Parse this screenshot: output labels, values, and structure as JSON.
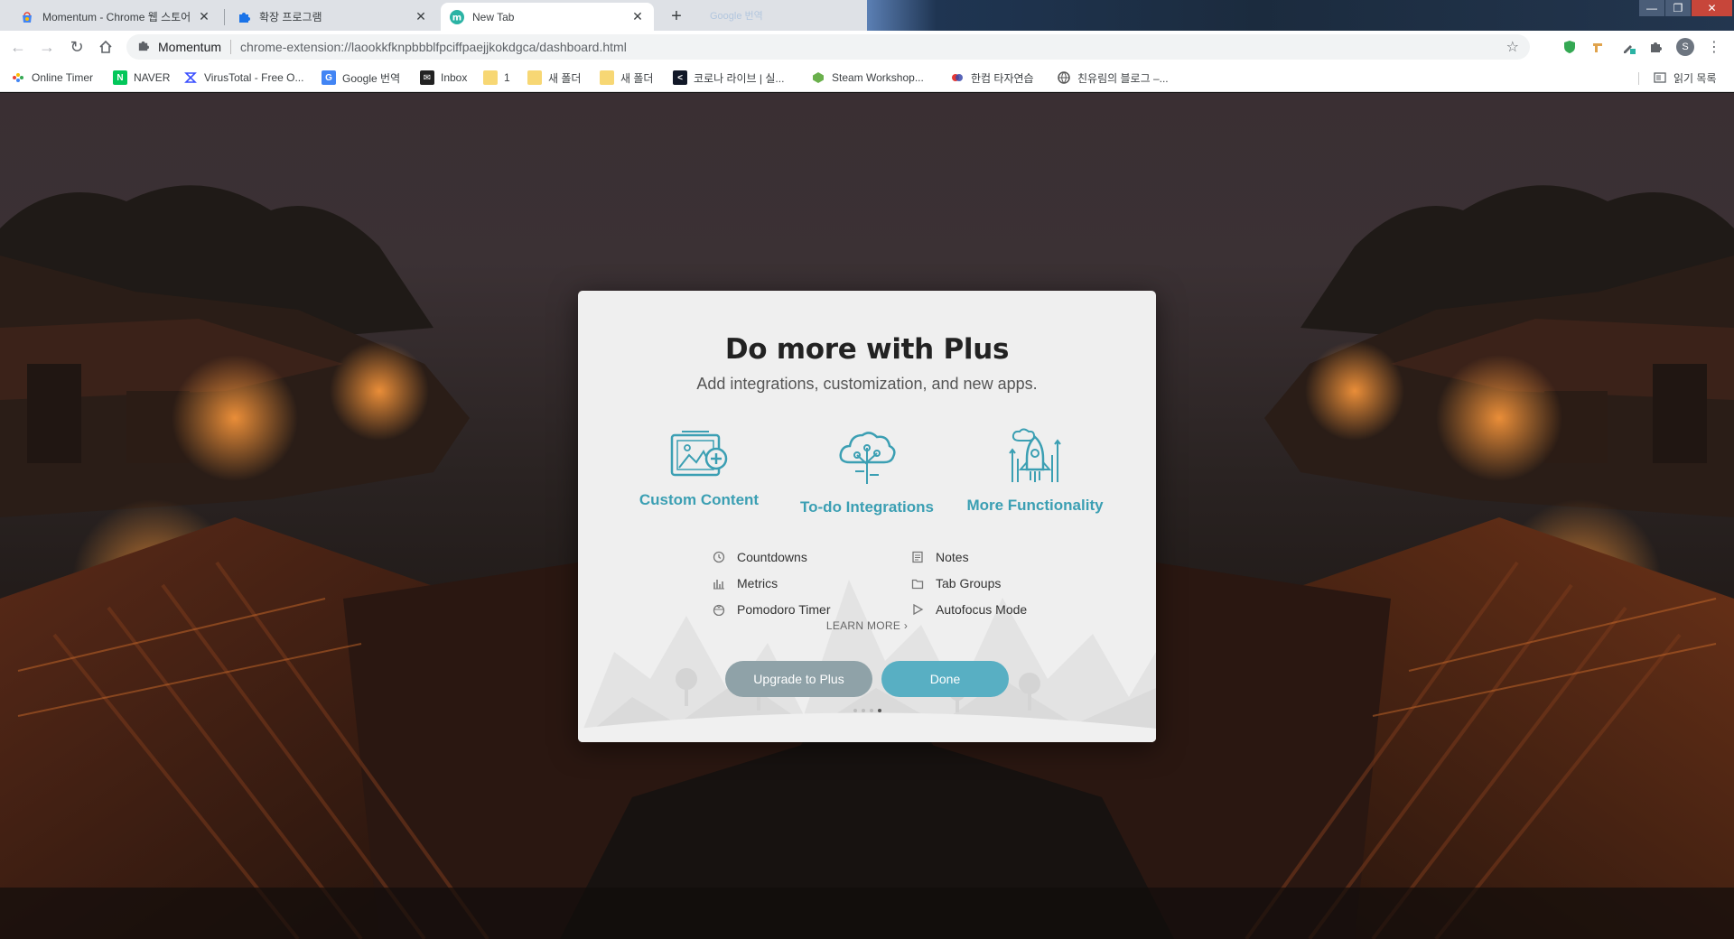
{
  "browser": {
    "tabs": [
      {
        "title": "Momentum - Chrome 웹 스토어",
        "icon": "chrome-webstore-icon",
        "active": false
      },
      {
        "title": "확장 프로그램",
        "icon": "puzzle-icon",
        "active": false
      },
      {
        "title": "New Tab",
        "icon": "momentum-icon",
        "active": true
      }
    ],
    "ghost_tab_title": "Google 번역",
    "omnibox": {
      "site_name": "Momentum",
      "url": "chrome-extension://laookkfknpbbblfpciffpaejjkokdgca/dashboard.html"
    },
    "profile_initial": "S",
    "bookmarks": [
      {
        "label": "Online Timer",
        "icon": "online-timer-icon"
      },
      {
        "label": "NAVER",
        "icon": "naver-icon"
      },
      {
        "label": "VirusTotal - Free O...",
        "icon": "virustotal-icon"
      },
      {
        "label": "Google 번역",
        "icon": "google-translate-icon"
      },
      {
        "label": "Inbox",
        "icon": "inbox-icon"
      },
      {
        "label": "1",
        "icon": "folder-icon"
      },
      {
        "label": "새 폴더",
        "icon": "folder-icon"
      },
      {
        "label": "새 폴더",
        "icon": "folder-icon"
      },
      {
        "label": "코로나 라이브 | 실...",
        "icon": "corona-live-icon"
      },
      {
        "label": "Steam Workshop...",
        "icon": "steam-workshop-icon"
      },
      {
        "label": "한컴 타자연습",
        "icon": "hancom-typing-icon"
      },
      {
        "label": "친유림의 블로그 –...",
        "icon": "blog-icon"
      }
    ],
    "reading_list_label": "읽기 목록"
  },
  "modal": {
    "title": "Do more with Plus",
    "subtitle": "Add integrations, customization, and new apps.",
    "features": [
      {
        "label": "Custom Content",
        "icon": "custom-content-icon"
      },
      {
        "label": "To-do Integrations",
        "icon": "todo-integrations-icon"
      },
      {
        "label": "More Functionality",
        "icon": "more-functionality-icon"
      }
    ],
    "list_left": [
      {
        "label": "Countdowns",
        "icon": "countdown-icon"
      },
      {
        "label": "Metrics",
        "icon": "metrics-icon"
      },
      {
        "label": "Pomodoro Timer",
        "icon": "pomodoro-icon"
      }
    ],
    "list_right": [
      {
        "label": "Notes",
        "icon": "notes-icon"
      },
      {
        "label": "Tab Groups",
        "icon": "tab-groups-icon"
      },
      {
        "label": "Autofocus Mode",
        "icon": "autofocus-icon"
      }
    ],
    "learn_more": "LEARN MORE",
    "upgrade_button": "Upgrade to Plus",
    "done_button": "Done",
    "page_dots": 4,
    "active_dot": 4,
    "accent_color": "#3b9fb3",
    "done_color": "#58afc3",
    "upgrade_color": "#8fa2a8"
  }
}
